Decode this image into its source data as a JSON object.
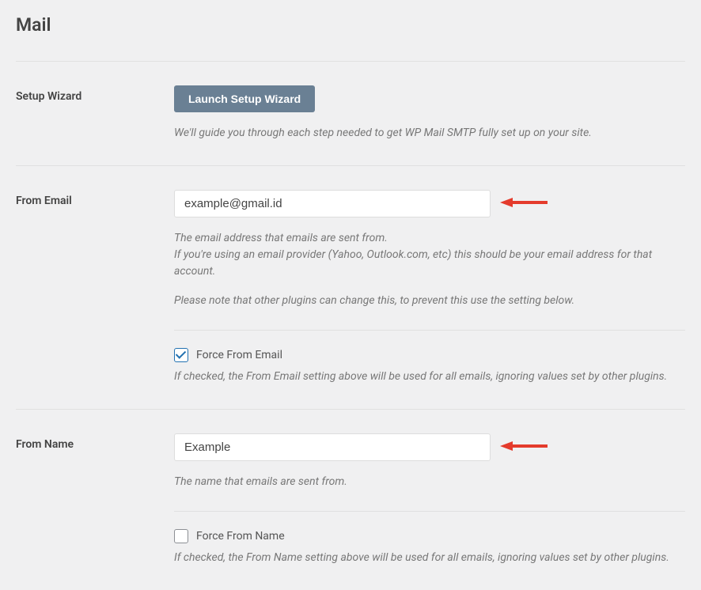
{
  "page": {
    "title": "Mail"
  },
  "wizard": {
    "label": "Setup Wizard",
    "button": "Launch Setup Wizard",
    "help": "We'll guide you through each step needed to get WP Mail SMTP fully set up on your site."
  },
  "from_email": {
    "label": "From Email",
    "value": "example@gmail.id",
    "help1": "The email address that emails are sent from.",
    "help2": "If you're using an email provider (Yahoo, Outlook.com, etc) this should be your email address for that account.",
    "help3": "Please note that other plugins can change this, to prevent this use the setting below.",
    "force_checked": true,
    "force_label": "Force From Email",
    "force_help": "If checked, the From Email setting above will be used for all emails, ignoring values set by other plugins."
  },
  "from_name": {
    "label": "From Name",
    "value": "Example",
    "help1": "The name that emails are sent from.",
    "force_checked": false,
    "force_label": "Force From Name",
    "force_help": "If checked, the From Name setting above will be used for all emails, ignoring values set by other plugins."
  }
}
